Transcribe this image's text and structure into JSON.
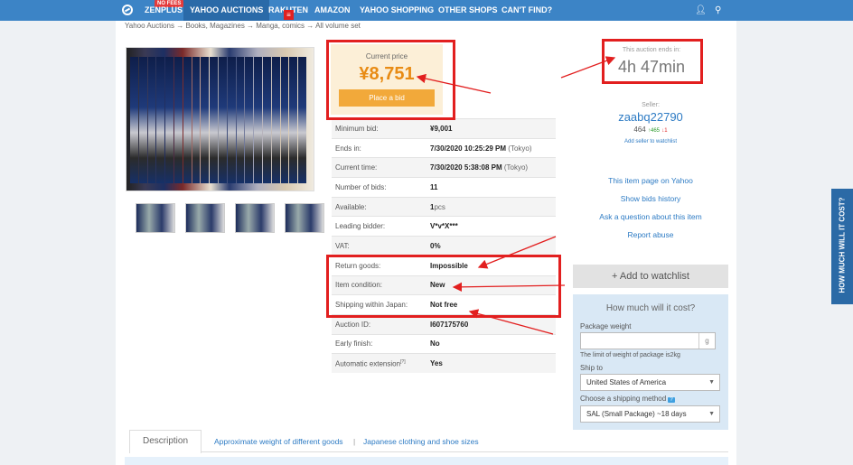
{
  "topnav": {
    "logo": "ZENPLUS",
    "badge": "NO FEES",
    "items": [
      "YAHOO AUCTIONS",
      "RAKUTEN",
      "AMAZON",
      "YAHOO SHOPPING",
      "OTHER SHOPS",
      "CAN'T FIND?"
    ]
  },
  "breadcrumb": "Yahoo Auctions → Books, Magazines → Manga, comics → All volume set",
  "price": {
    "label": "Current price",
    "value": "¥8,751",
    "bid_button": "Place a bid"
  },
  "specs": [
    {
      "label": "Minimum bid:",
      "value": "¥9,001"
    },
    {
      "label": "Ends in:",
      "value": "7/30/2020 10:25:29 PM",
      "suffix": "(Tokyo)"
    },
    {
      "label": "Current time:",
      "value": "7/30/2020 5:38:08 PM",
      "suffix": "(Tokyo)"
    },
    {
      "label": "Number of bids:",
      "value": "11"
    },
    {
      "label": "Available:",
      "value": "1",
      "suffix": "pcs"
    },
    {
      "label": "Leading bidder:",
      "value": "V*v*X***"
    },
    {
      "label": "VAT:",
      "value": "0%"
    },
    {
      "label": "Return goods:",
      "value": "Impossible"
    },
    {
      "label": "Item condition:",
      "value": "New"
    },
    {
      "label": "Shipping within Japan:",
      "value": "Not free"
    },
    {
      "label": "Auction ID:",
      "value": "l607175760"
    },
    {
      "label": "Early finish:",
      "value": "No"
    },
    {
      "label": "Automatic extension",
      "sup": "[?]",
      "value": "Yes"
    }
  ],
  "auction_end": {
    "label": "This auction ends in:",
    "value": "4h 47min"
  },
  "seller": {
    "label": "Seller:",
    "name": "zaabq22790",
    "rating": "464",
    "positive": "465",
    "negative": "1",
    "watch_link": "Add seller to watchlist"
  },
  "links": [
    "This item page on Yahoo",
    "Show bids history",
    "Ask a question about this item",
    "Report abuse"
  ],
  "watchlist_button": "+ Add to watchlist",
  "calculator": {
    "title": "How much will it cost?",
    "weight_label": "Package weight",
    "weight_unit": "g",
    "weight_hint": "The limit of weight of package is2kg",
    "ship_to_label": "Ship to",
    "ship_to_value": "United States of America",
    "method_label": "Choose a shipping method",
    "method_help": "?",
    "method_value": "SAL (Small Package) ~18 days"
  },
  "tabs": {
    "description": "Description",
    "link1": "Approximate weight of different goods",
    "sep": "|",
    "link2": "Japanese clothing and shoe sizes"
  },
  "side_tab": "HOW MUCH WILL IT COST?",
  "colors": {
    "nav": "#3c84c6",
    "accent": "#f2a93a",
    "price": "#e88b14",
    "annotation": "#e21f1f"
  }
}
